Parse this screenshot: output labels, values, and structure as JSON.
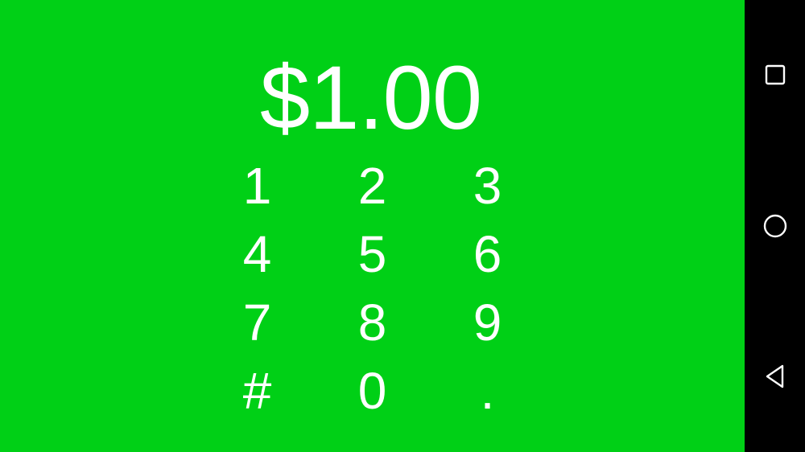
{
  "display": {
    "amount": "$1.00"
  },
  "keypad": {
    "keys": [
      "1",
      "2",
      "3",
      "4",
      "5",
      "6",
      "7",
      "8",
      "9",
      "#",
      "0",
      "."
    ]
  },
  "navbar": {
    "icons": [
      "recents-icon",
      "home-icon",
      "back-icon"
    ]
  },
  "colors": {
    "background": "#00d016",
    "text": "#ffffff",
    "navbar": "#000000"
  }
}
